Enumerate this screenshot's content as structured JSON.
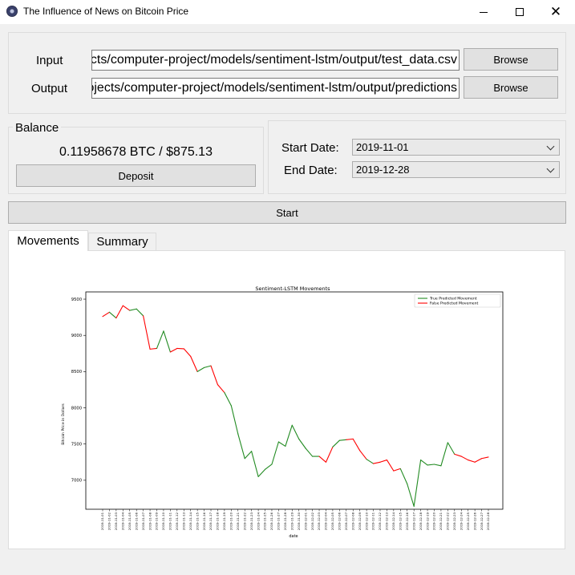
{
  "window": {
    "title": "The Influence of News on Bitcoin Price",
    "controls": {
      "minimize": "",
      "maximize": "",
      "close": "✕"
    }
  },
  "io": {
    "input_label": "Input",
    "input_value": "C:/Users/projects/computer-project/models/sentiment-lstm/output/test_data.csv",
    "output_label": "Output",
    "output_value": "C:/Users/projects/computer-project/models/sentiment-lstm/output/predictions",
    "browse_label": "Browse"
  },
  "balance": {
    "title": "Balance",
    "amount": "0.11958678 BTC / $875.13",
    "deposit_label": "Deposit"
  },
  "dates": {
    "start_label": "Start Date:",
    "start_value": "2019-11-01",
    "end_label": "End Date:",
    "end_value": "2019-12-28"
  },
  "start_button": "Start",
  "tabs": [
    {
      "label": "Movements",
      "active": true
    },
    {
      "label": "Summary",
      "active": false
    }
  ],
  "chart_data": {
    "type": "line",
    "title": "Sentiment-LSTM Movements",
    "xlabel": "date",
    "ylabel": "Bitcoin Price in Dollars",
    "ylim": [
      6600,
      9600
    ],
    "yticks": [
      7000,
      7500,
      8000,
      8500,
      9000,
      9500
    ],
    "grid": false,
    "legend_position": "top-right",
    "legend": [
      {
        "label": "True Predicted Movement",
        "color": "#228b22"
      },
      {
        "label": "False Predicted Movement",
        "color": "#ff0000"
      }
    ],
    "x": [
      "2019-11-01",
      "2019-11-02",
      "2019-11-03",
      "2019-11-04",
      "2019-11-05",
      "2019-11-06",
      "2019-11-07",
      "2019-11-08",
      "2019-11-09",
      "2019-11-10",
      "2019-11-11",
      "2019-11-12",
      "2019-11-13",
      "2019-11-14",
      "2019-11-15",
      "2019-11-16",
      "2019-11-17",
      "2019-11-18",
      "2019-11-19",
      "2019-11-20",
      "2019-11-21",
      "2019-11-22",
      "2019-11-23",
      "2019-11-24",
      "2019-11-25",
      "2019-11-26",
      "2019-11-27",
      "2019-11-28",
      "2019-11-29",
      "2019-11-30",
      "2019-12-01",
      "2019-12-02",
      "2019-12-03",
      "2019-12-04",
      "2019-12-05",
      "2019-12-06",
      "2019-12-07",
      "2019-12-08",
      "2019-12-09",
      "2019-12-10",
      "2019-12-11",
      "2019-12-12",
      "2019-12-13",
      "2019-12-14",
      "2019-12-15",
      "2019-12-16",
      "2019-12-17",
      "2019-12-18",
      "2019-12-19",
      "2019-12-20",
      "2019-12-21",
      "2019-12-22",
      "2019-12-23",
      "2019-12-24",
      "2019-12-25",
      "2019-12-26",
      "2019-12-27",
      "2019-12-28"
    ],
    "values": [
      9260,
      9320,
      9240,
      9410,
      9345,
      9365,
      9270,
      8810,
      8820,
      9060,
      8770,
      8820,
      8815,
      8710,
      8500,
      8555,
      8580,
      8320,
      8210,
      8030,
      7640,
      7300,
      7400,
      7050,
      7150,
      7220,
      7530,
      7470,
      7760,
      7570,
      7440,
      7330,
      7330,
      7250,
      7460,
      7550,
      7560,
      7570,
      7410,
      7290,
      7230,
      7250,
      7280,
      7130,
      7160,
      6950,
      6640,
      7280,
      7210,
      7220,
      7200,
      7520,
      7360,
      7330,
      7280,
      7250,
      7300,
      7320
    ],
    "segments": [
      "red",
      "green",
      "red",
      "red",
      "green",
      "green",
      "red",
      "red",
      "green",
      "green",
      "red",
      "red",
      "red",
      "red",
      "green",
      "green",
      "red",
      "red",
      "green",
      "green",
      "green",
      "green",
      "green",
      "green",
      "green",
      "green",
      "green",
      "green",
      "green",
      "green",
      "green",
      "green",
      "red",
      "red",
      "green",
      "green",
      "red",
      "red",
      "red",
      "green",
      "red",
      "red",
      "red",
      "red",
      "green",
      "green",
      "green",
      "green",
      "green",
      "green",
      "green",
      "green",
      "red",
      "red",
      "red",
      "red",
      "red"
    ]
  }
}
